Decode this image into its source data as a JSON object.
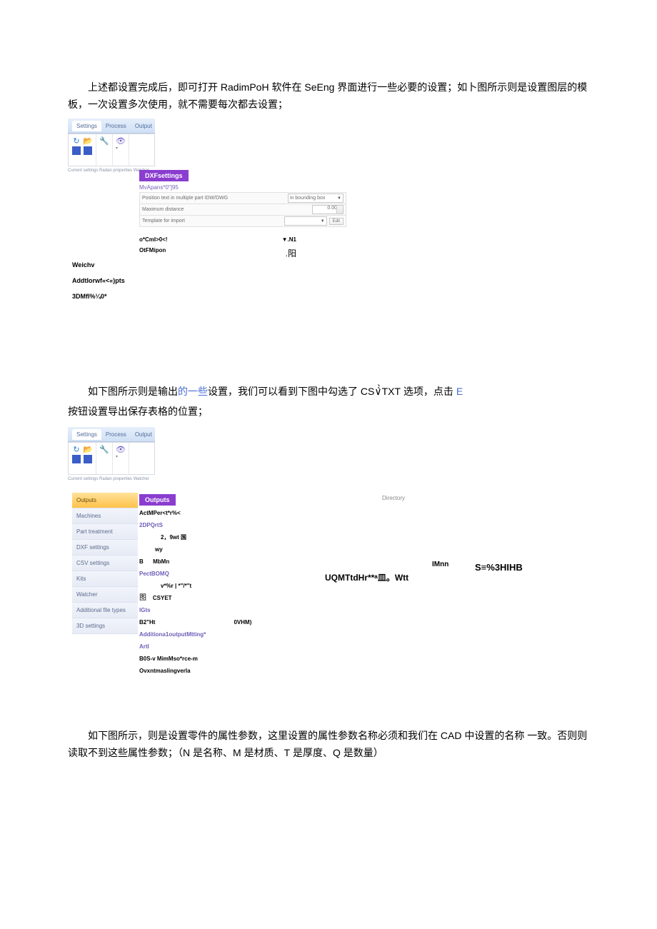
{
  "paragraphs": {
    "p1_a": "上述都设置完成后，即可打开 ",
    "p1_b": "RadimPoH",
    "p1_c": " 软件在 ",
    "p1_d": "SeEng",
    "p1_e": " 界面进行一些必要的设置；如卜图所示则是设置图层的模板，一次设置多次使用，就不需要每次都去设置；",
    "p2_a": "如下图所示则是输出",
    "p2_b": "的一些",
    "p2_c": "设置，我们可以看到下图中勾选了 ",
    "p2_d": "CS∨̀̀TXT",
    "p2_e": " 选项，点击 ",
    "p2_f": "E",
    "p3": "按钮设置导出保存表格的位置；",
    "p4_a": "如下图所示，则是设置零件的属性参数，这里设置的属性参数名称必须和我们在 ",
    "p4_b": "CAD",
    "p4_c": " 中设置的名称 一致。否则则读取不到这些属性参数；（",
    "p4_d": "N",
    "p4_e": " 是名称、",
    "p4_f": "M",
    "p4_g": " 是材质、",
    "p4_h": "T",
    "p4_i": " 是厚度、",
    "p4_j": "Q",
    "p4_k": " 是数量）"
  },
  "ribbon": {
    "tabs": {
      "settings": "Settings",
      "process": "Process",
      "output": "Output"
    },
    "footer": "Current settings  Radan properties  Watcher"
  },
  "dxf": {
    "header": "DXFsettings",
    "sub": "MvApans*0\"]95",
    "row1_label": "Position text in multiple part IDW/DWG",
    "row1_sel": "in bounding box",
    "row2_label": "Maximum distance",
    "row2_val": "0.00",
    "row3_label": "Template for import",
    "row3_btn": "Edit",
    "misc1a": "o*CmI>0<!",
    "misc1b": "▼.N1",
    "misc2a": "OtFMipon",
    "misc2b": ".阳",
    "weichv": "Weichv",
    "add": "AddtIorwf«<«)pts",
    "s3d": "3DMfl%¼0*"
  },
  "side": {
    "outputs": "Outputs",
    "machines": "Machines",
    "part": "Part treatment",
    "dxf": "DXF settings",
    "csv": "CSV settings",
    "kits": "Kits",
    "watcher": "Watcher",
    "aft": "Additional file types",
    "s3d": "3D settings"
  },
  "outputs": {
    "header": "Outputs",
    "dir": "Directory",
    "l1": "ActMPer<t*r%<",
    "l2": "2DPQrtS",
    "l3": "2，9wt 国",
    "l4a": "wy",
    "l4b": "B",
    "l4c": "MbMn",
    "l5": "PectBOMQ",
    "l6a": "v*%r | *\"/*\"t",
    "l6b": "图",
    "l6c": "CSYET",
    "l7": "IGts",
    "l8a": "B2\"Ht",
    "l8b": "0VHM)",
    "l9": "Additiona1outputMtting*",
    "l10": "ArtI",
    "l11": "B0S-v MimMso*rce-m",
    "l12": "Ovxntmaslingverla",
    "bigA": "UQMTtdHr**ᵃ皿。Wtt",
    "bigB": "IMnn",
    "bigC": "S≡%3HIHB"
  }
}
